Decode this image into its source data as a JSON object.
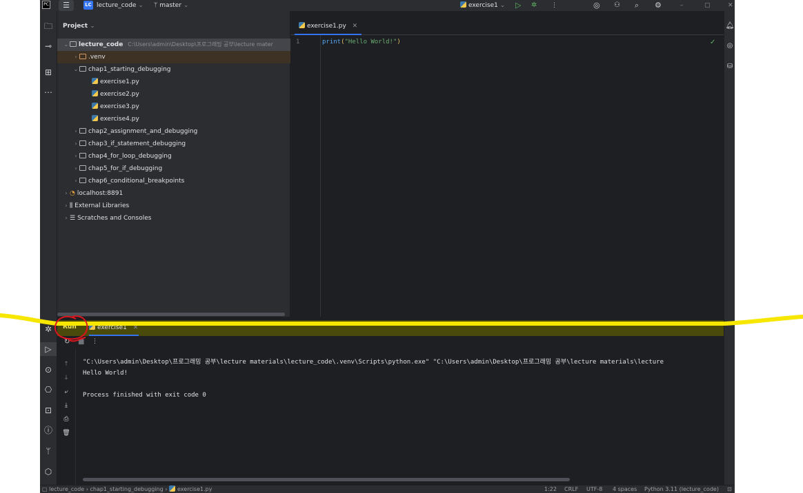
{
  "titlebar": {
    "project_badge": "LC",
    "project_name": "lecture_code",
    "branch": "master",
    "run_config": "exercise1"
  },
  "sidebar": {
    "title": "Project",
    "root_name": "lecture_code",
    "root_path": "C:\\Users\\admin\\Desktop\\프로그래밍 공부\\lecture mater",
    "items": [
      {
        "label": ".venv"
      },
      {
        "label": "chap1_starting_debugging"
      },
      {
        "label": "exercise1.py"
      },
      {
        "label": "exercise2.py"
      },
      {
        "label": "exercise3.py"
      },
      {
        "label": "exercise4.py"
      },
      {
        "label": "chap2_assignment_and_debugging"
      },
      {
        "label": "chap3_if_statement_debugging"
      },
      {
        "label": "chap4_for_loop_debugging"
      },
      {
        "label": "chap5_for_if_debugging"
      },
      {
        "label": "chap6_conditional_breakpoints"
      },
      {
        "label": "localhost:8891"
      },
      {
        "label": "External Libraries"
      },
      {
        "label": "Scratches and Consoles"
      }
    ]
  },
  "editor": {
    "tab_label": "exercise1.py",
    "line_number": "1",
    "code_fn": "print",
    "code_open": "(",
    "code_str": "\"Hello World!\"",
    "code_close": ")"
  },
  "run": {
    "tab_run": "Run",
    "tab_config": "exercise1",
    "console_lines": [
      "\"C:\\Users\\admin\\Desktop\\프로그래밍 공부\\lecture materials\\lecture_code\\.venv\\Scripts\\python.exe\" \"C:\\Users\\admin\\Desktop\\프로그래밍 공부\\lecture materials\\lecture",
      "Hello World!",
      "",
      "Process finished with exit code 0"
    ]
  },
  "statusbar": {
    "crumb_1": "lecture_code",
    "crumb_2": "chap1_starting_debugging",
    "crumb_3": "exercise1.py",
    "position": "1:22",
    "line_sep": "CRLF",
    "encoding": "UTF-8",
    "indent": "4 spaces",
    "interpreter": "Python 3.11 (lecture_code)"
  },
  "colors": {
    "accent": "#3574f0",
    "run_green": "#5fb865",
    "annotation_yellow": "#f7e600",
    "annotation_red": "#e0141e"
  }
}
